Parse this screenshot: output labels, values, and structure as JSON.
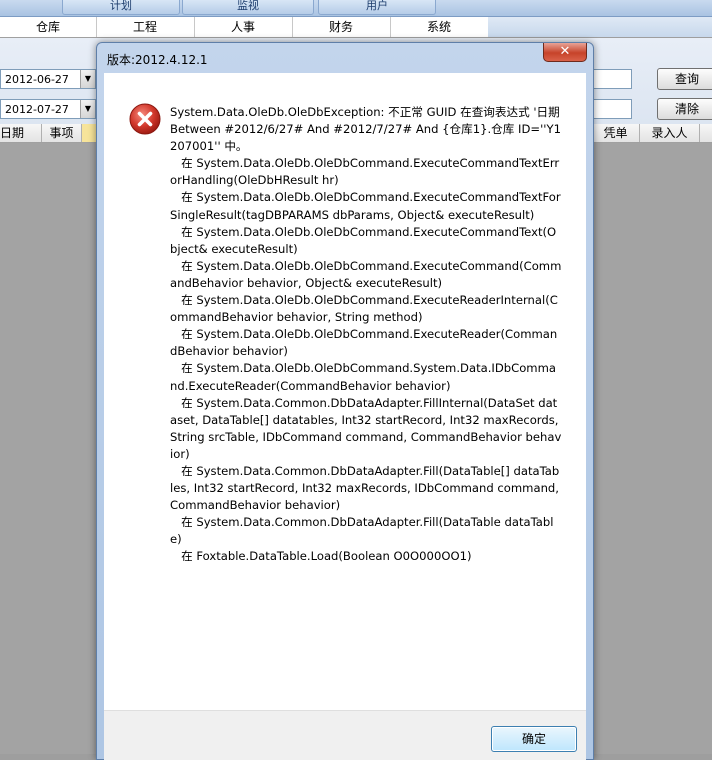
{
  "top_tabs": [
    "计划",
    "监视",
    "用户"
  ],
  "menu": [
    "仓库",
    "工程",
    "人事",
    "财务",
    "系统"
  ],
  "form": {
    "start_date": "2012-06-27",
    "end_date": "2012-07-27",
    "query_button": "查询",
    "clear_button": "清除"
  },
  "grid_columns": [
    "日期",
    "事项",
    "",
    "凭单",
    "录入人"
  ],
  "dialog": {
    "title": "版本:2012.4.12.1",
    "close_symbol": "✕",
    "ok_button": "确定",
    "message_lines": [
      "System.Data.OleDb.OleDbException: 不正常 GUID 在查询表达式 '日期 Between #2012/6/27# And #2012/7/27# And {仓库1}.仓库 ID=''Y1207001'' 中。",
      "   在 System.Data.OleDb.OleDbCommand.ExecuteCommandTextErrorHandling(OleDbHResult hr)",
      "   在 System.Data.OleDb.OleDbCommand.ExecuteCommandTextForSingleResult(tagDBPARAMS dbParams, Object& executeResult)",
      "   在 System.Data.OleDb.OleDbCommand.ExecuteCommandText(Object& executeResult)",
      "   在 System.Data.OleDb.OleDbCommand.ExecuteCommand(CommandBehavior behavior, Object& executeResult)",
      "   在 System.Data.OleDb.OleDbCommand.ExecuteReaderInternal(CommandBehavior behavior, String method)",
      "   在 System.Data.OleDb.OleDbCommand.ExecuteReader(CommandBehavior behavior)",
      "   在 System.Data.OleDb.OleDbCommand.System.Data.IDbCommand.ExecuteReader(CommandBehavior behavior)",
      "   在 System.Data.Common.DbDataAdapter.FillInternal(DataSet dataset, DataTable[] datatables, Int32 startRecord, Int32 maxRecords, String srcTable, IDbCommand command, CommandBehavior behavior)",
      "   在 System.Data.Common.DbDataAdapter.Fill(DataTable[] dataTables, Int32 startRecord, Int32 maxRecords, IDbCommand command, CommandBehavior behavior)",
      "   在 System.Data.Common.DbDataAdapter.Fill(DataTable dataTable)",
      "   在 Foxtable.DataTable.Load(Boolean O0O000OO1)"
    ]
  },
  "colors": {
    "error_red": "#d2382c",
    "column_highlight": "#f7e49a"
  }
}
